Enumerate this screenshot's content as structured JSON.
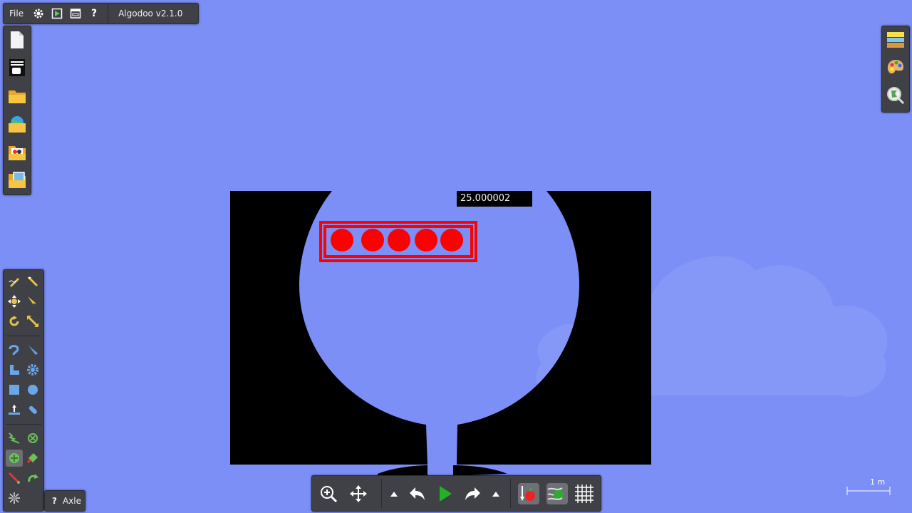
{
  "app": {
    "title": "Algodoo v2.1.0",
    "menu_file": "File"
  },
  "scene": {
    "value_label": "25.000002",
    "scale_label": "1 m",
    "colors": {
      "background": "#7b8ff7",
      "cloud": "#8a9cf8",
      "shape": "#000000",
      "box_outline": "#ff0000",
      "balls": "#ff0000"
    },
    "ball_count": 5
  },
  "help_tip": {
    "icon": "?",
    "label": "Axle"
  },
  "toolbars": {
    "file_tools": [
      "new-scene-icon",
      "scene-properties-icon",
      "open-folder-icon",
      "open-world-icon",
      "open-phunlet-icon",
      "open-image-icon"
    ],
    "right_tools": [
      "background-layers-icon",
      "color-palette-icon",
      "zoom-visualize-icon"
    ],
    "tool_palette": [
      "sketch-tool-icon",
      "cut-tool-icon",
      "move-tool-icon",
      "drag-tool-icon",
      "rotate-tool-icon",
      "scale-tool-icon",
      "rope-tool-icon",
      "knife-tool-icon",
      "brush-tool-icon",
      "gear-tool-icon",
      "box-tool-icon",
      "circle-tool-icon",
      "plane-tool-icon",
      "chain-tool-icon",
      "spring-tool-icon",
      "fixate-tool-icon",
      "axle-tool-icon",
      "thruster-tool-icon",
      "tracer-tool-icon",
      "hinge-tool-icon",
      "laser-tool-icon"
    ],
    "bottom_tools": [
      "zoom-icon",
      "pan-icon",
      "undo-options-icon",
      "undo-icon",
      "play-icon",
      "redo-icon",
      "redo-options-icon",
      "gravity-icon",
      "air-friction-icon",
      "grid-icon"
    ]
  }
}
